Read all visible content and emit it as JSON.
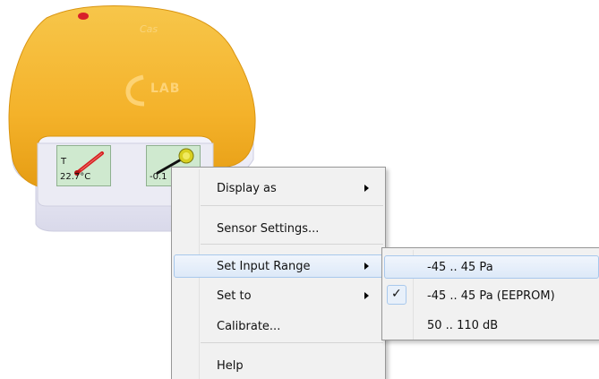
{
  "device": {
    "brand_logo_text": "LAB",
    "sensors": [
      {
        "letter": "T",
        "value": "22.7°C",
        "icon": "thermometer-icon"
      },
      {
        "value": "-0.1",
        "icon": "microphone-icon"
      }
    ]
  },
  "context_menu": {
    "items": [
      {
        "label": "Display as",
        "has_submenu": true
      },
      {
        "label": "Sensor Settings..."
      },
      {
        "label": "Set Input Range",
        "has_submenu": true,
        "highlighted": true
      },
      {
        "label": "Set to",
        "has_submenu": true
      },
      {
        "label": "Calibrate..."
      },
      {
        "label": "Help"
      }
    ]
  },
  "submenu": {
    "items": [
      {
        "label": "-45 .. 45 Pa",
        "highlighted": true
      },
      {
        "label": "-45 .. 45 Pa (EEPROM)",
        "checked": true
      },
      {
        "label": "50 .. 110 dB"
      }
    ]
  },
  "colors": {
    "device_body": "#f5b529",
    "sensor_panel": "#cfe9cf",
    "menu_bg": "#f1f1f1",
    "highlight_border": "#a8c8ec"
  }
}
